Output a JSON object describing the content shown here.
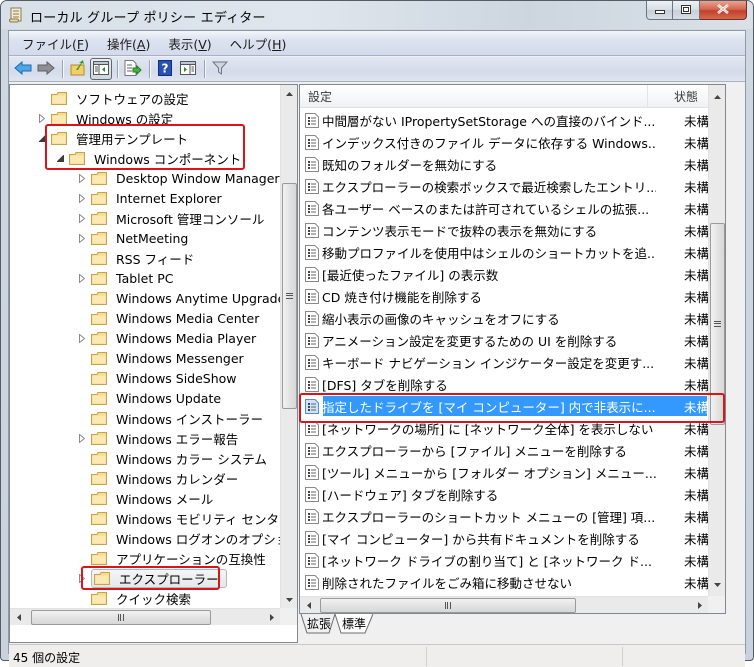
{
  "window": {
    "title": "ローカル グループ ポリシー エディター",
    "app_icon": "policy-scroll-icon",
    "caption_buttons": [
      "minimize",
      "maximize",
      "close"
    ]
  },
  "menu": [
    {
      "label": "ファイル(",
      "key": "F",
      "suffix": ")"
    },
    {
      "label": "操作(",
      "key": "A",
      "suffix": ")"
    },
    {
      "label": "表示(",
      "key": "V",
      "suffix": ")"
    },
    {
      "label": "ヘルプ(",
      "key": "H",
      "suffix": ")"
    }
  ],
  "toolbar": {
    "buttons": [
      {
        "icon": "back-arrow-icon"
      },
      {
        "icon": "forward-arrow-icon"
      },
      {
        "icon": "up-folder-icon"
      },
      {
        "icon": "show-hide-tree-icon",
        "pressed": true
      },
      {
        "icon": "export-list-icon"
      },
      {
        "icon": "help-icon"
      },
      {
        "icon": "show-action-pane-icon"
      },
      {
        "icon": "filter-icon"
      }
    ]
  },
  "tree": {
    "items": [
      {
        "label": "ソフトウェアの設定",
        "level": 1,
        "expander": "none"
      },
      {
        "label": "Windows の設定",
        "level": 1,
        "expander": "collapsed"
      },
      {
        "label": "管理用テンプレート",
        "level": 1,
        "expander": "expanded"
      },
      {
        "label": "Windows コンポーネント",
        "level": 2,
        "expander": "expanded"
      },
      {
        "label": "Desktop Window Manager",
        "level": 3,
        "expander": "collapsed"
      },
      {
        "label": "Internet Explorer",
        "level": 3,
        "expander": "collapsed"
      },
      {
        "label": "Microsoft 管理コンソール",
        "level": 3,
        "expander": "collapsed"
      },
      {
        "label": "NetMeeting",
        "level": 3,
        "expander": "collapsed"
      },
      {
        "label": "RSS フィード",
        "level": 3,
        "expander": "none"
      },
      {
        "label": "Tablet PC",
        "level": 3,
        "expander": "collapsed"
      },
      {
        "label": "Windows Anytime Upgrade",
        "level": 3,
        "expander": "none"
      },
      {
        "label": "Windows Media Center",
        "level": 3,
        "expander": "none"
      },
      {
        "label": "Windows Media Player",
        "level": 3,
        "expander": "collapsed"
      },
      {
        "label": "Windows Messenger",
        "level": 3,
        "expander": "none"
      },
      {
        "label": "Windows SideShow",
        "level": 3,
        "expander": "none"
      },
      {
        "label": "Windows Update",
        "level": 3,
        "expander": "none"
      },
      {
        "label": "Windows インストーラー",
        "level": 3,
        "expander": "none"
      },
      {
        "label": "Windows エラー報告",
        "level": 3,
        "expander": "collapsed"
      },
      {
        "label": "Windows カラー システム",
        "level": 3,
        "expander": "none"
      },
      {
        "label": "Windows カレンダー",
        "level": 3,
        "expander": "none"
      },
      {
        "label": "Windows メール",
        "level": 3,
        "expander": "none"
      },
      {
        "label": "Windows モビリティ センター",
        "level": 3,
        "expander": "none"
      },
      {
        "label": "Windows ログオンのオプション",
        "level": 3,
        "expander": "none"
      },
      {
        "label": "アプリケーションの互換性",
        "level": 3,
        "expander": "none"
      },
      {
        "label": "エクスプローラー",
        "level": 3,
        "expander": "collapsed",
        "selected": true
      },
      {
        "label": "クイック検索",
        "level": 3,
        "expander": "none"
      }
    ]
  },
  "list": {
    "columns": {
      "setting": "設定",
      "state": "状態"
    },
    "rows": [
      {
        "name": "中間層がない IPropertySetStorage への直接のバインド...",
        "state": "未構成"
      },
      {
        "name": "インデックス付きのファイル データに依存する Windows...",
        "state": "未構成"
      },
      {
        "name": "既知のフォルダーを無効にする",
        "state": "未構成"
      },
      {
        "name": "エクスプローラーの検索ボックスで最近検索したエントリ...",
        "state": "未構成"
      },
      {
        "name": "各ユーザー ベースのまたは許可されているシェルの拡張...",
        "state": "未構成"
      },
      {
        "name": "コンテンツ表示モードで抜粋の表示を無効にする",
        "state": "未構成"
      },
      {
        "name": "移動プロファイルを使用中はシェルのショートカットを追...",
        "state": "未構成"
      },
      {
        "name": "[最近使ったファイル] の表示数",
        "state": "未構成"
      },
      {
        "name": "CD 焼き付け機能を削除する",
        "state": "未構成"
      },
      {
        "name": "縮小表示の画像のキャッシュをオフにする",
        "state": "未構成"
      },
      {
        "name": "アニメーション設定を変更するための UI を削除する",
        "state": "未構成"
      },
      {
        "name": "キーボード ナビゲーション インジケーター設定を変更す...",
        "state": "未構成"
      },
      {
        "name": "[DFS] タブを削除する",
        "state": "未構成"
      },
      {
        "name": "指定したドライブを [マイ コンピューター] 内で非表示に...",
        "state": "未構成",
        "selected": true
      },
      {
        "name": "[ネットワークの場所] に [ネットワーク全体] を表示しない",
        "state": "未構成"
      },
      {
        "name": "エクスプローラーから [ファイル] メニューを削除する",
        "state": "未構成"
      },
      {
        "name": "[ツール] メニューから [フォルダー オプション] メニュー...",
        "state": "未構成"
      },
      {
        "name": "[ハードウェア] タブを削除する",
        "state": "未構成"
      },
      {
        "name": "エクスプローラーのショートカット メニューの [管理] 項...",
        "state": "未構成"
      },
      {
        "name": "[マイ コンピューター] から共有ドキュメントを削除する",
        "state": "未構成"
      },
      {
        "name": "[ネットワーク ドライブの割り当て] と [ネットワーク ド...",
        "state": "未構成"
      },
      {
        "name": "削除されたファイルをごみ箱に移動させない",
        "state": "未構成"
      }
    ]
  },
  "tabs": [
    {
      "label": "拡張",
      "active": false
    },
    {
      "label": "標準",
      "active": true
    }
  ],
  "status": {
    "text": "45 個の設定"
  },
  "colors": {
    "selection": "#3399ff",
    "annotation_red": "#d9141b",
    "folder": "#f3d27a"
  }
}
